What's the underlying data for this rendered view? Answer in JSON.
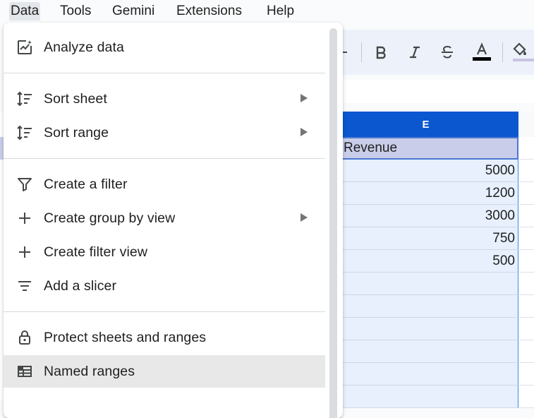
{
  "menubar": {
    "items": [
      "Data",
      "Tools",
      "Gemini",
      "Extensions",
      "Help"
    ]
  },
  "toolbar": {
    "icons": [
      "plus-icon",
      "bold-icon",
      "italic-icon",
      "strikethrough-icon",
      "text-color-icon",
      "fill-color-icon"
    ],
    "text_color": "#000000"
  },
  "grid": {
    "column_label": "E",
    "header_cell": "Revenue",
    "values": [
      "5000",
      "1200",
      "3000",
      "750",
      "500",
      "",
      "",
      "",
      "",
      "",
      ""
    ]
  },
  "menu": {
    "items": [
      {
        "label": "Analyze data",
        "icon": "analyze-data-icon"
      },
      {
        "label": "Sort sheet",
        "icon": "sort-icon",
        "submenu": true
      },
      {
        "label": "Sort range",
        "icon": "sort-icon",
        "submenu": true
      },
      {
        "label": "Create a filter",
        "icon": "filter-icon"
      },
      {
        "label": "Create group by view",
        "icon": "plus-icon",
        "submenu": true
      },
      {
        "label": "Create filter view",
        "icon": "plus-icon"
      },
      {
        "label": "Add a slicer",
        "icon": "slicer-icon"
      },
      {
        "label": "Protect sheets and ranges",
        "icon": "lock-icon"
      },
      {
        "label": "Named ranges",
        "icon": "named-ranges-icon",
        "highlighted": true
      }
    ]
  },
  "colors": {
    "accent": "#0b57d0",
    "selection_fill": "#e7f0fc",
    "header_fill": "#c9cde9"
  }
}
